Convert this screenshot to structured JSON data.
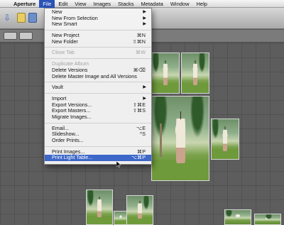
{
  "menubar": {
    "apple": "",
    "items": [
      "Aperture",
      "File",
      "Edit",
      "View",
      "Images",
      "Stacks",
      "Metadata",
      "Window",
      "Help"
    ]
  },
  "file_menu": {
    "group1": [
      {
        "label": "New",
        "submenu": true
      },
      {
        "label": "New From Selection",
        "submenu": true
      },
      {
        "label": "New Smart",
        "submenu": true
      }
    ],
    "group2": [
      {
        "label": "New Project",
        "shortcut": "⌘N"
      },
      {
        "label": "New Folder",
        "shortcut": "⇧⌘N"
      }
    ],
    "group3": [
      {
        "label": "Close Tab",
        "shortcut": "⌘W",
        "disabled": true
      }
    ],
    "group4": [
      {
        "label": "Duplicate Album",
        "disabled": true
      },
      {
        "label": "Delete Versions",
        "shortcut": "⌘⌫"
      },
      {
        "label": "Delete Master Image and All Versions"
      }
    ],
    "group5": [
      {
        "label": "Vault",
        "submenu": true
      }
    ],
    "group6": [
      {
        "label": "Import",
        "submenu": true
      },
      {
        "label": "Export Versions...",
        "shortcut": "⇧⌘E"
      },
      {
        "label": "Export Masters...",
        "shortcut": "⇧⌘S"
      },
      {
        "label": "Migrate Images..."
      }
    ],
    "group7": [
      {
        "label": "Email...",
        "shortcut": "⌥E"
      },
      {
        "label": "Slideshow...",
        "shortcut": "^S"
      },
      {
        "label": "Order Prints..."
      }
    ],
    "group8": [
      {
        "label": "Print Images...",
        "shortcut": "⌘P"
      },
      {
        "label": "Print Light Table...",
        "shortcut": "⌥⌘P",
        "selected": true
      }
    ]
  },
  "icons": {
    "apple": "apple-icon",
    "arrow": "▶",
    "down": "⇩"
  }
}
